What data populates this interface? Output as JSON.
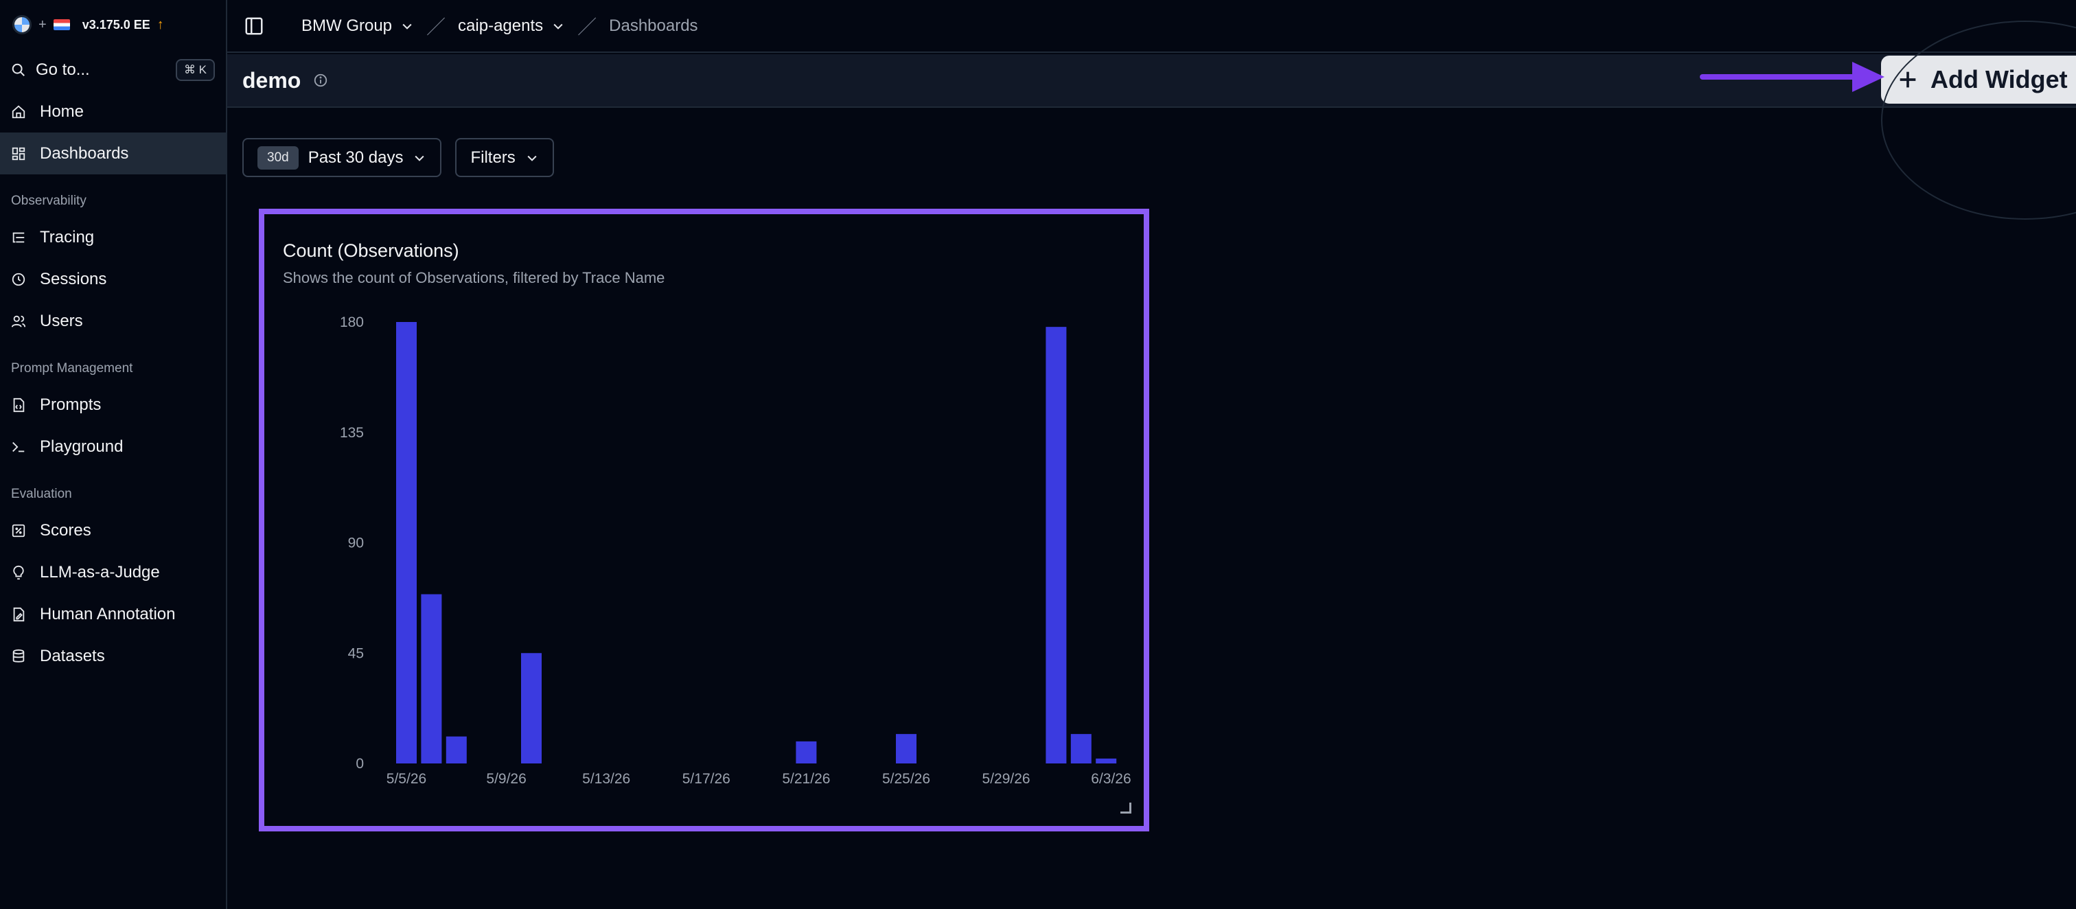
{
  "brand": {
    "version": "v3.175.0 EE",
    "plus": "+"
  },
  "sidebar": {
    "goto": {
      "label": "Go to...",
      "shortcut": "⌘ K"
    },
    "top_items": [
      {
        "label": "Home",
        "icon": "home-icon"
      },
      {
        "label": "Dashboards",
        "icon": "dashboard-icon",
        "active": true
      }
    ],
    "sections": [
      {
        "title": "Observability",
        "items": [
          {
            "label": "Tracing",
            "icon": "list-tree-icon"
          },
          {
            "label": "Sessions",
            "icon": "clock-icon"
          },
          {
            "label": "Users",
            "icon": "users-icon"
          }
        ]
      },
      {
        "title": "Prompt Management",
        "items": [
          {
            "label": "Prompts",
            "icon": "file-code-icon"
          },
          {
            "label": "Playground",
            "icon": "terminal-icon"
          }
        ]
      },
      {
        "title": "Evaluation",
        "items": [
          {
            "label": "Scores",
            "icon": "square-percent-icon"
          },
          {
            "label": "LLM-as-a-Judge",
            "icon": "lightbulb-icon"
          },
          {
            "label": "Human Annotation",
            "icon": "annotation-icon"
          },
          {
            "label": "Datasets",
            "icon": "database-icon"
          }
        ]
      }
    ]
  },
  "breadcrumb": {
    "org": "BMW Group",
    "project": "caip-agents",
    "page": "Dashboards"
  },
  "header": {
    "title": "demo",
    "add_widget": "Add Widget"
  },
  "filters": {
    "range_tag": "30d",
    "range_label": "Past 30 days",
    "filters_label": "Filters"
  },
  "widget": {
    "title": "Count (Observations)",
    "subtitle": "Shows the count of Observations, filtered by Trace Name"
  },
  "colors": {
    "accent": "#8b5cf6",
    "bar": "#3b3be0",
    "background": "#030712"
  },
  "chart_data": {
    "type": "bar",
    "title": "Count (Observations)",
    "subtitle": "Shows the count of Observations, filtered by Trace Name",
    "ylim": [
      0,
      180
    ],
    "yticks": [
      0,
      45,
      90,
      135,
      180
    ],
    "xticks": [
      "5/5/26",
      "5/9/26",
      "5/13/26",
      "5/17/26",
      "5/21/26",
      "5/25/26",
      "5/29/26",
      "6/3/26"
    ],
    "categories": [
      "5/5/26",
      "5/6/26",
      "5/7/26",
      "5/8/26",
      "5/9/26",
      "5/10/26",
      "5/11/26",
      "5/12/26",
      "5/13/26",
      "5/14/26",
      "5/15/26",
      "5/16/26",
      "5/17/26",
      "5/18/26",
      "5/19/26",
      "5/20/26",
      "5/21/26",
      "5/22/26",
      "5/23/26",
      "5/24/26",
      "5/25/26",
      "5/26/26",
      "5/27/26",
      "5/28/26",
      "5/29/26",
      "5/30/26",
      "5/31/26",
      "6/1/26",
      "6/2/26",
      "6/3/26"
    ],
    "values": [
      180,
      69,
      11,
      0,
      0,
      45,
      0,
      0,
      0,
      0,
      0,
      0,
      0,
      0,
      0,
      0,
      9,
      0,
      0,
      0,
      12,
      0,
      0,
      0,
      0,
      0,
      178,
      12,
      2,
      0
    ],
    "grid": false,
    "legend": "none"
  }
}
